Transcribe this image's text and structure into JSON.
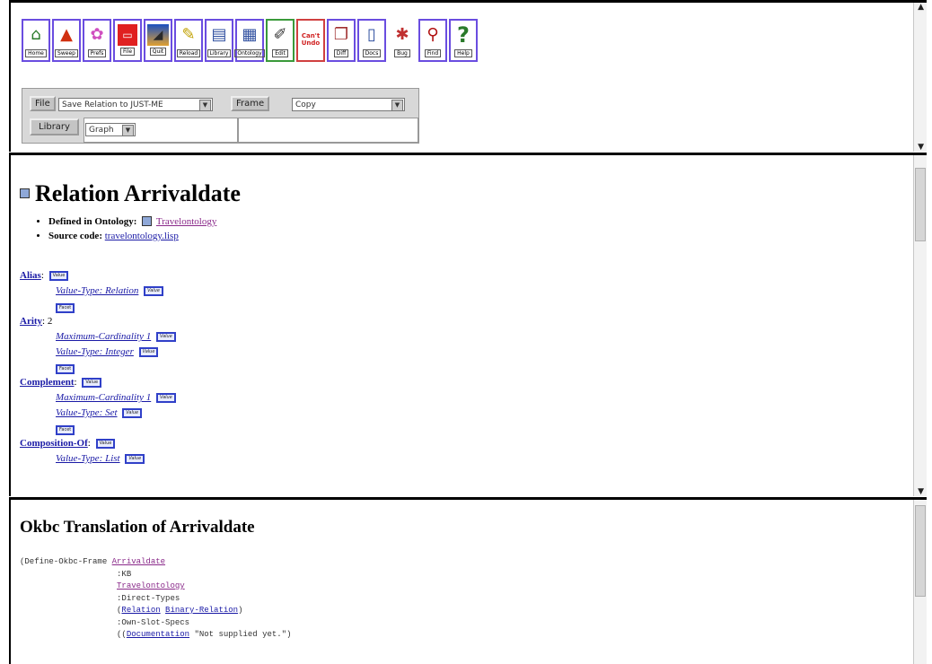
{
  "toolbar": {
    "buttons": [
      {
        "label": "Home",
        "icon": "home-icon",
        "glyph": "⌂"
      },
      {
        "label": "Sweep",
        "icon": "sweep-icon",
        "glyph": "▲"
      },
      {
        "label": "Prefs",
        "icon": "prefs-icon",
        "glyph": "✿"
      },
      {
        "label": "File",
        "icon": "file-icon",
        "glyph": "▭"
      },
      {
        "label": "Quit",
        "icon": "quit-icon",
        "glyph": "◢"
      },
      {
        "label": "Reload",
        "icon": "reload-icon",
        "glyph": "✎"
      },
      {
        "label": "Library",
        "icon": "library-icon",
        "glyph": "▤"
      },
      {
        "label": "Ontology",
        "icon": "ontology-icon",
        "glyph": "▦"
      },
      {
        "label": "Edit",
        "icon": "edit-icon",
        "glyph": "✐"
      },
      {
        "label": "Can't Undo",
        "icon": "undo-icon",
        "glyph": ""
      },
      {
        "label": "Diff",
        "icon": "diff-icon",
        "glyph": "❐"
      },
      {
        "label": "Docs",
        "icon": "docs-icon",
        "glyph": "▯"
      },
      {
        "label": "Bug",
        "icon": "bug-icon",
        "glyph": "✱"
      },
      {
        "label": "Find",
        "icon": "find-icon",
        "glyph": "⚲"
      },
      {
        "label": "Help",
        "icon": "help-icon",
        "glyph": "?"
      }
    ]
  },
  "panel": {
    "file_label": "File",
    "file_select": "Save Relation to JUST-ME",
    "frame_label": "Frame",
    "frame_select": "Copy",
    "library_label": "Library",
    "library_select": "Graph"
  },
  "relation": {
    "title": "Relation Arrivaldate",
    "defined_label": "Defined in Ontology:",
    "defined_value": "Travelontology",
    "source_label": "Source code:",
    "source_value": "travelontology.lisp",
    "value_btn": "Value",
    "facet_btn": "Facet",
    "slots": {
      "alias": {
        "name": "Alias",
        "facets": [
          "Value-Type: Relation"
        ]
      },
      "arity": {
        "name": "Arity",
        "value": "2",
        "facets": [
          "Maximum-Cardinality 1",
          "Value-Type: Integer"
        ]
      },
      "complement": {
        "name": "Complement",
        "facets": [
          "Maximum-Cardinality 1",
          "Value-Type: Set"
        ]
      },
      "composition": {
        "name": "Composition-Of",
        "facets": [
          "Value-Type: List"
        ]
      }
    }
  },
  "okbc": {
    "title": "Okbc Translation of Arrivaldate",
    "line1_kw": "(Define-Okbc-Frame",
    "line1_link": "Arrivaldate",
    "line2": ":KB",
    "line3_link": "Travelontology",
    "line4": ":Direct-Types",
    "line5_a": "Relation",
    "line5_b": "Binary-Relation",
    "line6": ":Own-Slot-Specs",
    "line7_link": "Documentation",
    "line7_text": "\"Not supplied yet.\""
  },
  "colors": {
    "link": "#1a1aa6",
    "visited": "#8a2a8a",
    "button_border": "#6a4de0"
  }
}
